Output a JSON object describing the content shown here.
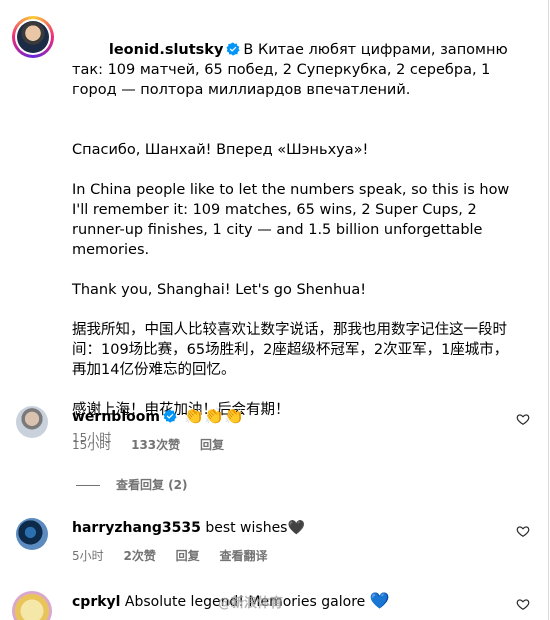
{
  "caption": {
    "username": "leonid.slutsky",
    "ru_text_1": "В Китае любят цифрами, запомню так: 109 матчей, 65 побед, 2 Суперкубка, 2 серебра, 1 город — полтора миллиардов впечатлений.",
    "ru_text_2": "Спасибо, Шанхай! Вперед «Шэньхуа»!",
    "en_text_1": "In China people like to let the numbers speak, so this is how I'll remember it: 109 matches, 65 wins, 2 Super Cups, 2 runner-up finishes, 1 city — and 1.5 billion unforgettable memories.",
    "en_text_2": "Thank you, Shanghai! Let's go Shenhua!",
    "zh_text_1": "据我所知，中国人比较喜欢让数字说话，那我也用数字记住这一段时间：109场比赛，65场胜利，2座超级杯冠军，2次亚军，1座城市，再加14亿份难忘的回忆。",
    "zh_text_2": "感谢上海！申花加油！后会有期！",
    "time": "15小时"
  },
  "comments": [
    {
      "username": "wernbloom",
      "text": "👏👏👏",
      "time": "15小时",
      "likes": "133次赞",
      "reply": "回复",
      "view_replies": "查看回复 (2)"
    },
    {
      "username": "harryzhang3535",
      "text": "best wishes🖤",
      "time": "5小时",
      "likes": "2次赞",
      "reply": "回复",
      "translate": "查看翻译"
    },
    {
      "username": "cprkyl",
      "text": "Absolute legend! Memories galore",
      "emoji": "💙"
    }
  ],
  "watermark": "@新浪体育",
  "icons": {
    "verified": "verified-badge-icon",
    "like": "heart-outline-icon"
  },
  "colors": {
    "verified": "#0095f6",
    "meta": "#737373"
  }
}
